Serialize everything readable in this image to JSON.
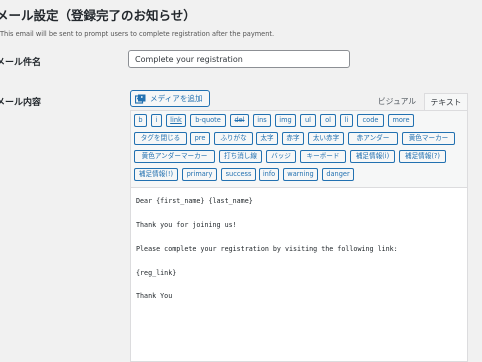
{
  "section": {
    "title": "メール設定（登録完了のお知らせ）",
    "description": "This email will be sent to prompt users to complete registration after the payment."
  },
  "subject": {
    "label": "メール件名",
    "value": "Complete your registration"
  },
  "body": {
    "label": "メール内容",
    "media_button": "メディアを追加",
    "media_icon": "add-media-icon",
    "tabs": {
      "visual": "ビジュアル",
      "text": "テキスト"
    },
    "quicktags": [
      [
        "b",
        "i",
        "link",
        "b-quote",
        "del",
        "ins",
        "img",
        "ul",
        "ol",
        "li",
        "code",
        "more"
      ],
      [
        "タグを閉じる",
        "pre",
        "ふりがな",
        "太字",
        "赤字",
        "太い赤字",
        "赤アンダー",
        "黄色マーカー"
      ],
      [
        "黄色アンダーマーカー",
        "打ち消し線",
        "バッジ",
        "キーボード",
        "補足情報(i)",
        "補足情報(?)"
      ],
      [
        "補足情報(!)",
        "primary",
        "success",
        "info",
        "warning",
        "danger"
      ]
    ],
    "content_lines": [
      "Dear {first_name} {last_name}",
      "Thank you for joining us!",
      "Please complete your registration by visiting the following link:",
      "{reg_link}",
      "Thank You"
    ]
  },
  "colors": {
    "accent": "#2271b1",
    "background": "#f1f1f1"
  }
}
